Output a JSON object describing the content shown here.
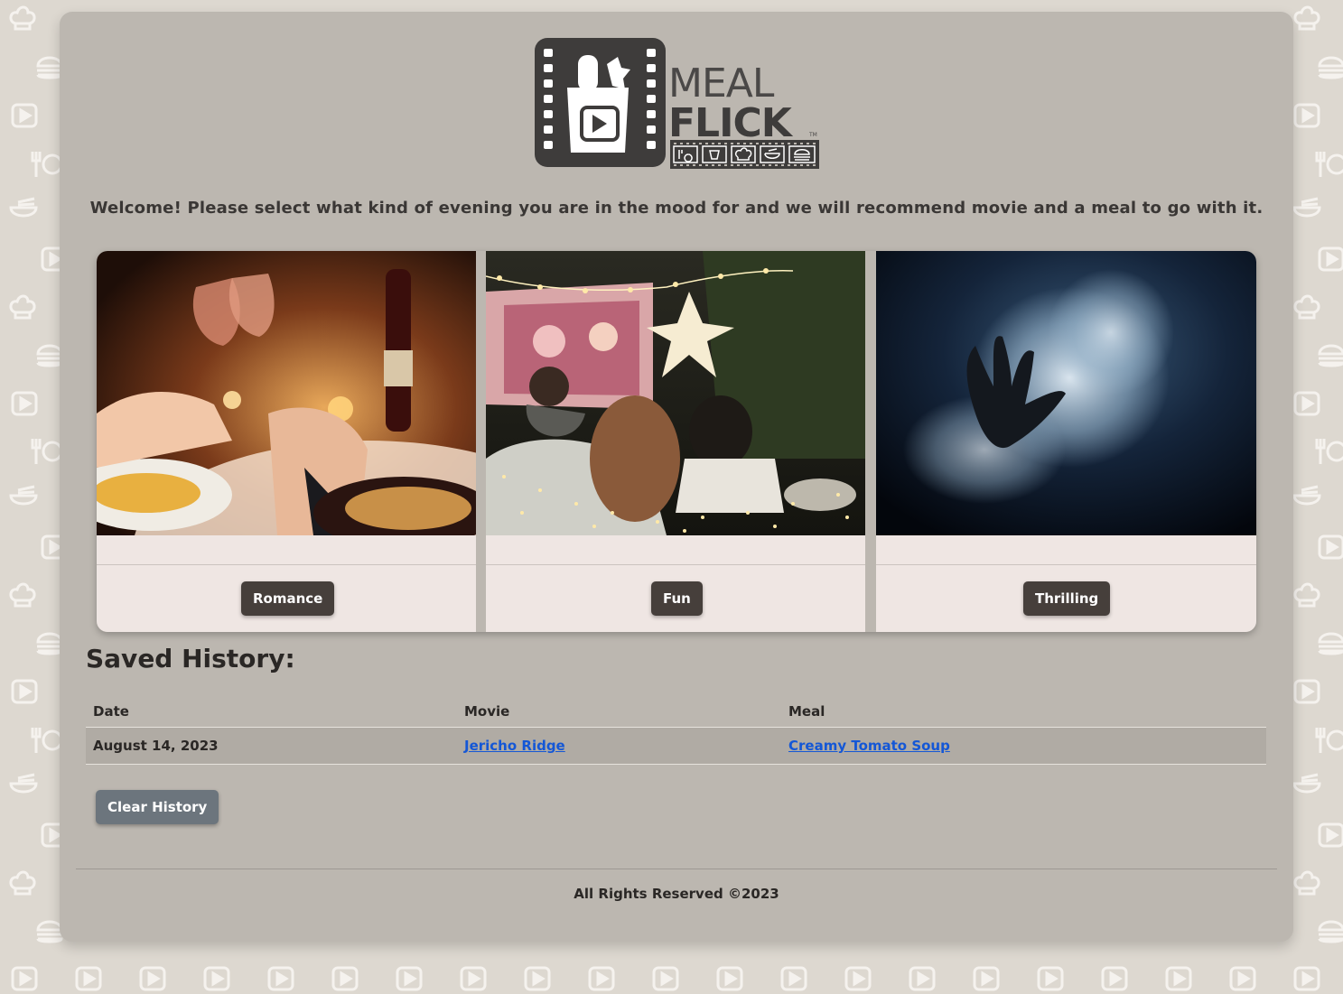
{
  "brand": {
    "logo_text_top": "MEAL",
    "logo_text_bottom": "FLICK",
    "trademark": "TM"
  },
  "welcome": "Welcome! Please select what kind of evening you are in the mood for and we will recommend movie and a meal to go with it.",
  "moods": [
    {
      "label": "Romance"
    },
    {
      "label": "Fun"
    },
    {
      "label": "Thrilling"
    }
  ],
  "history": {
    "title": "Saved History:",
    "columns": [
      "Date",
      "Movie",
      "Meal"
    ],
    "rows": [
      {
        "date": "August 14, 2023",
        "movie": "Jericho Ridge",
        "meal": "Creamy Tomato Soup"
      }
    ],
    "clear_label": "Clear History"
  },
  "footer": "All Rights Reserved ©2023",
  "colors": {
    "page_bg": "#ddd8d0",
    "panel_bg": "#bcb7b0",
    "card_bg": "#efe6e3",
    "button_dark": "#463f3b",
    "button_gray": "#6c757d",
    "link": "#1457d6"
  }
}
